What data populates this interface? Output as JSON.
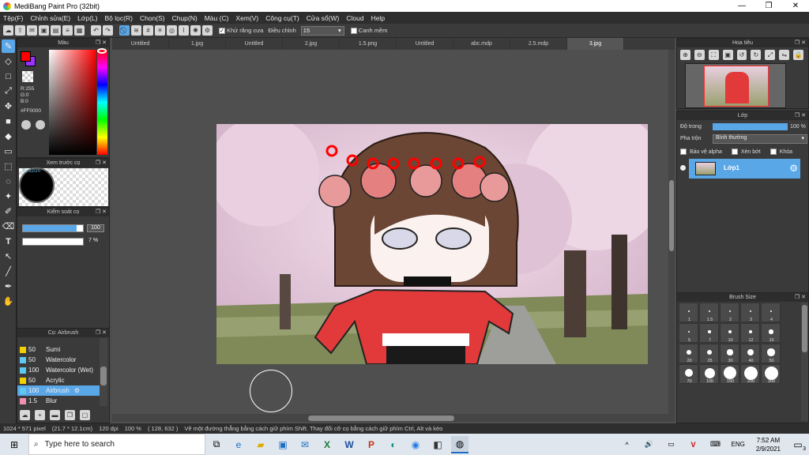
{
  "window": {
    "title": "MediBang Paint Pro (32bit)",
    "minimize": "—",
    "maximize": "❐",
    "close": "✕"
  },
  "menu": [
    "Tệp(F)",
    "Chỉnh sửa(E)",
    "Lớp(L)",
    "Bộ lọc(R)",
    "Chọn(S)",
    "Chụp(N)",
    "Màu (C)",
    "Xem(V)",
    "Công cụ(T)",
    "Cửa sổ(W)",
    "Cloud",
    "Help"
  ],
  "toolbar": {
    "antialias_label": "Khử răng cưa",
    "adjust_label": "Điều chỉnh",
    "adjust_value": "15",
    "smooth_label": "Canh mềm"
  },
  "tabs": [
    {
      "label": "Untitled"
    },
    {
      "label": "1.jpg"
    },
    {
      "label": "Untitled"
    },
    {
      "label": "2.jpg"
    },
    {
      "label": "1.5.png"
    },
    {
      "label": "Untitled"
    },
    {
      "label": "abc.mdp"
    },
    {
      "label": "2.5.mdp"
    },
    {
      "label": "3.jpg"
    }
  ],
  "color_panel": {
    "title": "Màu",
    "r": "R:255",
    "g": "G:0",
    "b": "B:0",
    "hex": "#FF0000",
    "fg": "#ff0000",
    "bg": "#9b30ff"
  },
  "brush_preview": {
    "title": "Xem trước cọ",
    "size_label": "31.12cm"
  },
  "brush_control": {
    "title": "Kiểm soát cọ",
    "size_value": "100",
    "opacity_value": "7 %"
  },
  "brush_panel": {
    "title": "Cọ: Airbrush",
    "brushes": [
      {
        "size": "50",
        "name": "Sumi",
        "color": "#f0d000"
      },
      {
        "size": "50",
        "name": "Watercolor",
        "color": "#5ec8f0"
      },
      {
        "size": "100",
        "name": "Watercolor (Wet)",
        "color": "#5ec8f0"
      },
      {
        "size": "50",
        "name": "Acrylic",
        "color": "#f0d000"
      },
      {
        "size": "100",
        "name": "Airbrush",
        "color": "#5ec8f0"
      },
      {
        "size": "1.5",
        "name": "Blur",
        "color": "#f08fb0"
      }
    ]
  },
  "navigator": {
    "title": "Hoa tiêu"
  },
  "layer_panel": {
    "title": "Lớp",
    "opacity_label": "Độ trong",
    "opacity_value": "100 %",
    "blend_label": "Pha trộn",
    "blend_value": "Bình thường",
    "protect_alpha": "Bảo vệ alpha",
    "clipping": "Xén bớt",
    "lock": "Khóa",
    "layer_name": "Lớp1"
  },
  "brush_size": {
    "title": "Brush Size",
    "sizes": [
      "1",
      "1.5",
      "2",
      "3",
      "4",
      "5",
      "7",
      "10",
      "12",
      "15",
      "20",
      "25",
      "30",
      "40",
      "50",
      "70",
      "100",
      "150",
      "200",
      "300"
    ]
  },
  "status": {
    "pixels": "1024 * 571 pixel",
    "cm": "(21.7 * 12.1cm)",
    "dpi": "120 dpi",
    "zoom": "100 %",
    "coord": "( 128, 632 )",
    "hint": "Vẽ một đường thẳng bằng cách giữ phím Shift. Thay đổi cỡ cọ bằng cách giữ phím Ctrl, Alt và kéo"
  },
  "taskbar": {
    "search_placeholder": "Type here to search",
    "lang": "ENG",
    "time": "7:52 AM",
    "date": "2/9/2021",
    "notif": "3"
  }
}
